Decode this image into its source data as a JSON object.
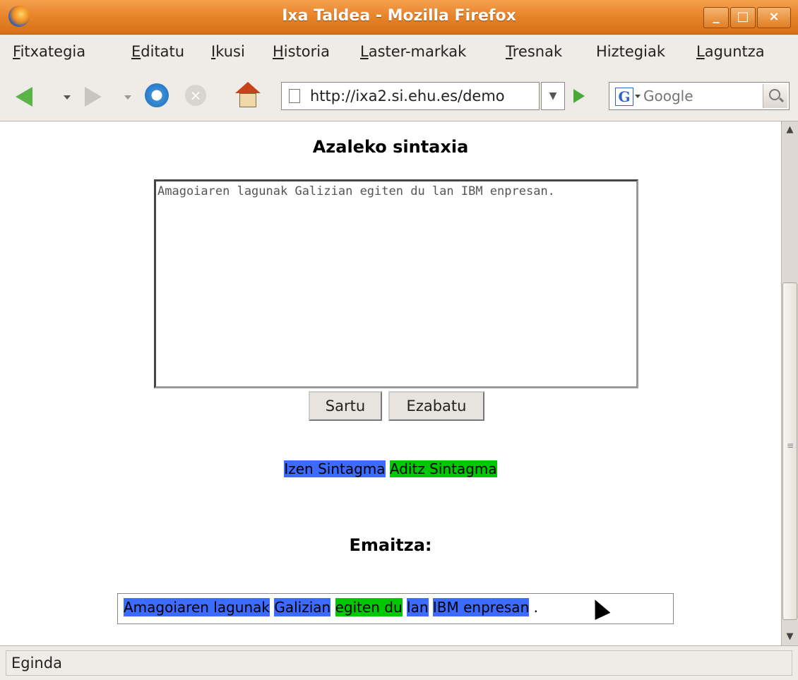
{
  "window": {
    "title": "Ixa Taldea - Mozilla Firefox"
  },
  "menu": {
    "items": [
      {
        "u": "F",
        "rest": "itxategia"
      },
      {
        "u": "E",
        "rest": "ditatu"
      },
      {
        "u": "I",
        "rest": "kusi"
      },
      {
        "u": "H",
        "rest": "istoria"
      },
      {
        "u": "L",
        "rest": "aster-markak"
      },
      {
        "u": "T",
        "rest": "resnak"
      },
      {
        "u": "",
        "rest": "Hiztegiak"
      },
      {
        "u": "L",
        "rest": "aguntza"
      }
    ]
  },
  "toolbar": {
    "url": "http://ixa2.si.ehu.es/demo",
    "search_placeholder": "Google",
    "search_engine_letter": "G"
  },
  "page": {
    "heading": "Azaleko sintaxia",
    "textarea_value": "Amagoiaren lagunak Galizian egiten du lan IBM enpresan.",
    "submit_label": "Sartu",
    "clear_label": "Ezabatu",
    "legend": {
      "iz": "Izen Sintagma",
      "ad": "Aditz Sintagma"
    },
    "result_heading": "Emaitza:",
    "result_chunks": [
      {
        "text": "Amagoiaren lagunak",
        "type": "iz"
      },
      {
        "text": "Galizian",
        "type": "iz"
      },
      {
        "text": "egiten du",
        "type": "ad"
      },
      {
        "text": "lan",
        "type": "iz"
      },
      {
        "text": "IBM enpresan",
        "type": "iz"
      },
      {
        "text": ".",
        "type": "none"
      }
    ]
  },
  "status": {
    "text": "Eginda"
  },
  "colors": {
    "iz": "#3b6cff",
    "ad": "#00c800"
  }
}
